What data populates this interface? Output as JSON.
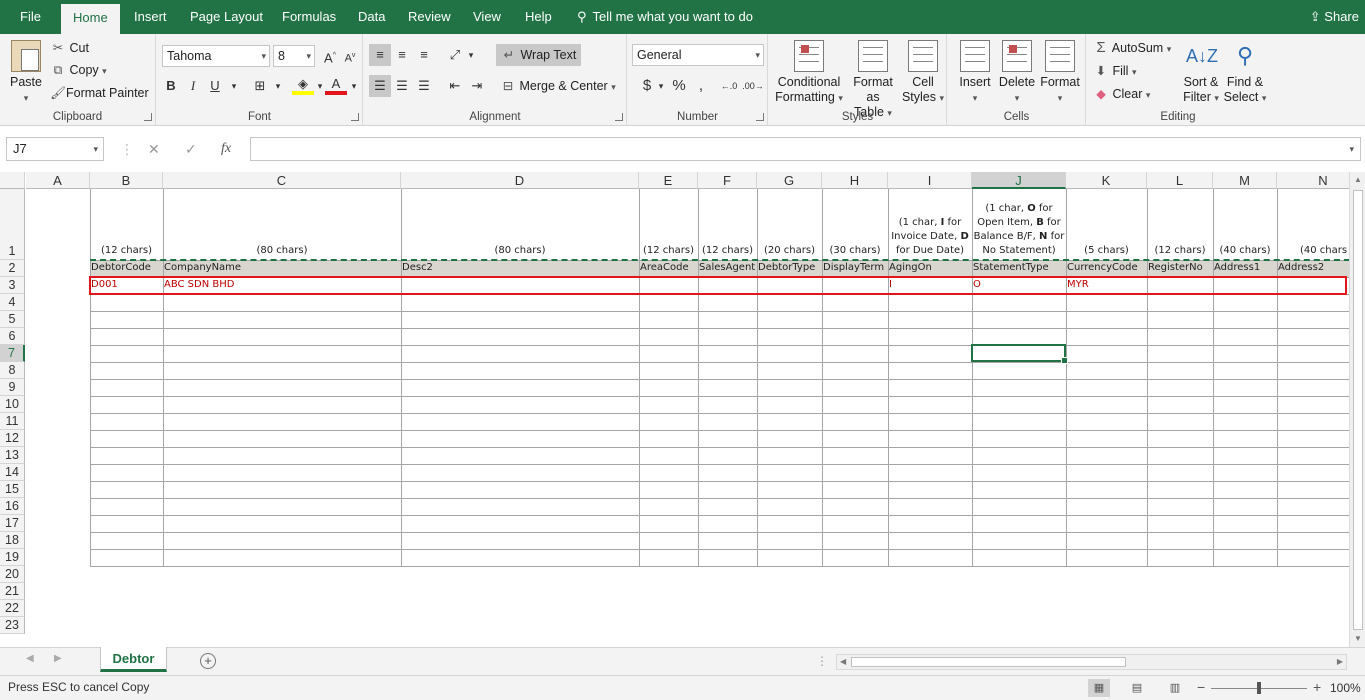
{
  "ribbon_tabs": [
    "File",
    "Home",
    "Insert",
    "Page Layout",
    "Formulas",
    "Data",
    "Review",
    "View",
    "Help"
  ],
  "active_tab": "Home",
  "tell_me": "Tell me what you want to do",
  "share": "Share",
  "clipboard": {
    "paste": "Paste",
    "cut": "Cut",
    "copy": "Copy",
    "format_painter": "Format Painter",
    "label": "Clipboard"
  },
  "font": {
    "name": "Tahoma",
    "size": "8",
    "bold": "B",
    "italic": "I",
    "underline": "U",
    "label": "Font"
  },
  "alignment": {
    "wrap_text": "Wrap Text",
    "merge_center": "Merge & Center",
    "label": "Alignment"
  },
  "number": {
    "format": "General",
    "currency": "$",
    "percent": "%",
    "comma": ",",
    "label": "Number"
  },
  "styles": {
    "conditional": "Conditional",
    "conditional2": "Formatting",
    "format_as": "Format as",
    "format_as2": "Table",
    "cell": "Cell",
    "cell2": "Styles",
    "label": "Styles"
  },
  "cells": {
    "insert": "Insert",
    "delete": "Delete",
    "format": "Format",
    "label": "Cells"
  },
  "editing": {
    "autosum": "AutoSum",
    "fill": "Fill",
    "clear": "Clear",
    "sort": "Sort &",
    "sort2": "Filter",
    "find": "Find &",
    "find2": "Select",
    "label": "Editing"
  },
  "formula_bar": {
    "name_box": "J7",
    "cancel": "✕",
    "enter": "✓",
    "fx": "fx",
    "content": ""
  },
  "columns": [
    "A",
    "B",
    "C",
    "D",
    "E",
    "F",
    "G",
    "H",
    "I",
    "J",
    "K",
    "L",
    "M",
    "N"
  ],
  "selected_column": "J",
  "rows": [
    "1",
    "2",
    "3",
    "4",
    "5",
    "6",
    "7",
    "8",
    "9",
    "10",
    "11",
    "12",
    "13",
    "14",
    "15",
    "16",
    "17",
    "18",
    "19",
    "20",
    "21",
    "22",
    "23"
  ],
  "selected_row": "7",
  "row1_notes": {
    "B": "(12 chars)",
    "C": "(80 chars)",
    "D": "(80 chars)",
    "E": "(12 chars)",
    "F": "(12 chars)",
    "G": "(20 chars)",
    "H": "(30 chars)",
    "I_lines": [
      "(1 char, I for",
      "Invoice Date, D",
      "for Due Date)"
    ],
    "J_lines": [
      "(1 char, O for",
      "Open Item, B for",
      "Balance B/F, N for",
      "No Statement)"
    ],
    "K": "(5 chars)",
    "L": "(12 chars)",
    "M": "(40 chars)",
    "N": "(40 chars"
  },
  "header_row": {
    "B": "DebtorCode",
    "C": "CompanyName",
    "D": "Desc2",
    "E": "AreaCode",
    "F": "SalesAgent",
    "G": "DebtorType",
    "H": "DisplayTerm",
    "I": "AgingOn",
    "J": "StatementType",
    "K": "CurrencyCode",
    "L": "RegisterNo",
    "M": "Address1",
    "N": "Address2"
  },
  "data_row": {
    "B": "D001",
    "C": "ABC SDN BHD",
    "I": "I",
    "J": "O",
    "K": "MYR"
  },
  "sheet_tab": "Debtor",
  "status_message": "Press ESC to cancel Copy",
  "zoom": "100%",
  "colors": {
    "brand": "#217346",
    "highlight_box": "#e0161c",
    "data_text": "#c00000",
    "header_fill": "#d9d6cf"
  }
}
